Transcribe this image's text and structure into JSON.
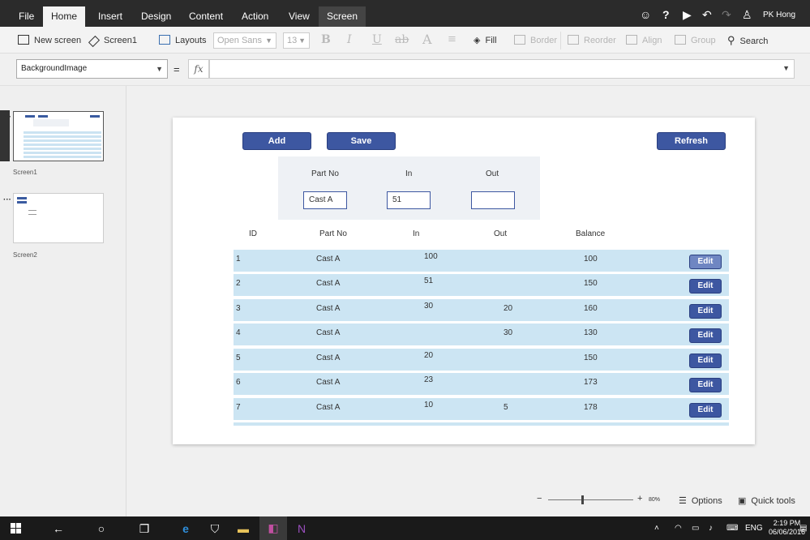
{
  "menu": {
    "tabs": [
      "File",
      "Home",
      "Insert",
      "Design",
      "Content",
      "Action",
      "View",
      "Screen"
    ],
    "active_tab": "Home",
    "user": "PK Hong"
  },
  "ribbon": {
    "new_screen": "New screen",
    "screen_name": "Screen1",
    "layouts": "Layouts",
    "font": "Open Sans",
    "font_size": "13",
    "fill": "Fill",
    "border": "Border",
    "reorder": "Reorder",
    "align": "Align",
    "group": "Group",
    "search": "Search"
  },
  "formula_bar": {
    "property": "BackgroundImage",
    "equals": "=",
    "fx": "fx",
    "formula": ""
  },
  "screens": [
    {
      "label": "Screen1",
      "selected": true
    },
    {
      "label": "Screen2",
      "selected": false
    }
  ],
  "canvas": {
    "buttons": {
      "add": "Add",
      "save": "Save",
      "refresh": "Refresh"
    },
    "form": {
      "part_no_label": "Part No",
      "in_label": "In",
      "out_label": "Out",
      "part_no_value": "Cast A",
      "in_value": "51",
      "out_value": ""
    },
    "headers": [
      "ID",
      "Part No",
      "In",
      "Out",
      "Balance"
    ],
    "rows": [
      {
        "id": "1",
        "part": "Cast A",
        "in": "100",
        "out": "",
        "balance": "100"
      },
      {
        "id": "2",
        "part": "Cast A",
        "in": "51",
        "out": "",
        "balance": "150"
      },
      {
        "id": "3",
        "part": "Cast A",
        "in": "30",
        "out": "20",
        "balance": "160"
      },
      {
        "id": "4",
        "part": "Cast A",
        "in": "",
        "out": "30",
        "balance": "130"
      },
      {
        "id": "5",
        "part": "Cast A",
        "in": "20",
        "out": "",
        "balance": "150"
      },
      {
        "id": "6",
        "part": "Cast A",
        "in": "23",
        "out": "",
        "balance": "173"
      },
      {
        "id": "7",
        "part": "Cast A",
        "in": "10",
        "out": "5",
        "balance": "178"
      }
    ],
    "edit_label": "Edit"
  },
  "status": {
    "zoom_minus": "−",
    "zoom_plus": "+",
    "zoom": "80%",
    "options": "Options",
    "quick_tools": "Quick tools"
  },
  "taskbar": {
    "lang": "ENG",
    "time": "2:19 PM",
    "date": "06/06/2016"
  },
  "colors": {
    "accent": "#3d57a1",
    "row_bg": "#cce5f3",
    "menubar": "#2b2b2b"
  }
}
